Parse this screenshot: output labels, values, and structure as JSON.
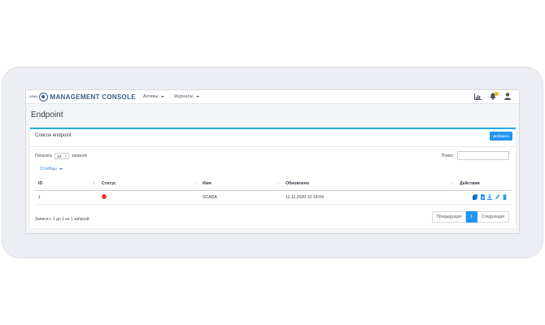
{
  "app": {
    "logo_small": "ARMA",
    "brand": "MANAGEMENT CONSOLE"
  },
  "nav": {
    "items": [
      {
        "label": "Активы"
      },
      {
        "label": "Журналы"
      }
    ],
    "icons": [
      "chart-icon",
      "bell-icon",
      "user-icon"
    ],
    "notification_color": "#f0c020"
  },
  "page": {
    "title": "Endpoint"
  },
  "card": {
    "title": "Список endpoint",
    "add_label": "Добавить"
  },
  "controls": {
    "show_label": "Показать",
    "page_length": "10",
    "entries_label": "записей",
    "search_label": "Поиск:",
    "search_value": "",
    "columns_label": "Столбцы"
  },
  "table": {
    "headers": [
      "ID",
      "Статус",
      "Имя",
      "Обновлено",
      "Действия"
    ],
    "rows": [
      {
        "id": "1",
        "status": "red",
        "name": "SCADA",
        "updated": "11.11.2020 12:14:04",
        "actions": [
          "copy-icon",
          "file-icon",
          "download-icon",
          "edit-icon",
          "delete-icon"
        ]
      }
    ]
  },
  "footer": {
    "info": "Записи с 1 до 1 из 1 записей",
    "prev_label": "Предыдущая",
    "current_page": "1",
    "next_label": "Следующая"
  },
  "colors": {
    "accent": "#2196f3",
    "status_red": "#e53935",
    "card_top_border": "#2aa8d8"
  }
}
